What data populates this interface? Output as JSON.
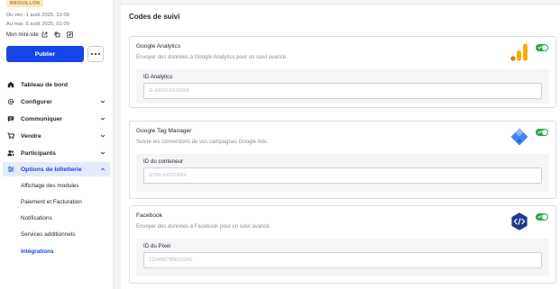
{
  "sidebar": {
    "status_badge": "BROUILLON",
    "date_start": "Du ven. 1 août 2025, 12:00",
    "date_end": "Au mar. 5 août 2025, 01:00",
    "site_link": "Mon mini-site",
    "publish_label": "Publier",
    "nav": [
      {
        "label": "Tableau de bord",
        "icon": "home-icon"
      },
      {
        "label": "Configurer",
        "icon": "gear-icon"
      },
      {
        "label": "Communiquer",
        "icon": "chat-icon"
      },
      {
        "label": "Vendre",
        "icon": "cart-icon"
      },
      {
        "label": "Participants",
        "icon": "users-icon"
      },
      {
        "label": "Options de billetterie",
        "icon": "sliders-icon"
      }
    ],
    "sub_items": [
      {
        "label": "Affichage des modules"
      },
      {
        "label": "Paiement et Facturation"
      },
      {
        "label": "Notifications"
      },
      {
        "label": "Services additionnels"
      },
      {
        "label": "Intégrations"
      }
    ]
  },
  "main": {
    "title": "Codes de suivi",
    "cards": [
      {
        "title": "Google Analytics",
        "description": "Envoyer des données à Google Analytics pour un suivi avancé.",
        "field_label": "ID Analytics",
        "placeholder": "G-XXXXXXXXXX",
        "value": "",
        "enabled": true,
        "logo": "google-analytics-icon"
      },
      {
        "title": "Google Tag Manager",
        "description": "Suivre les conversions de vos campagnes Google Ads.",
        "field_label": "ID du conteneur",
        "placeholder": "GTM-XXXXXXX",
        "value": "",
        "enabled": true,
        "logo": "google-tag-manager-icon"
      },
      {
        "title": "Facebook",
        "description": "Envoyer des données à Facebook pour un suivi avancé.",
        "field_label": "ID du Pixel",
        "placeholder": "123456789012345",
        "value": "",
        "enabled": true,
        "logo": "code-icon"
      }
    ]
  },
  "colors": {
    "accent": "#1746e8",
    "toggle_on": "#27a844",
    "badge_bg": "#fbe9c6",
    "badge_text": "#b7791f"
  }
}
